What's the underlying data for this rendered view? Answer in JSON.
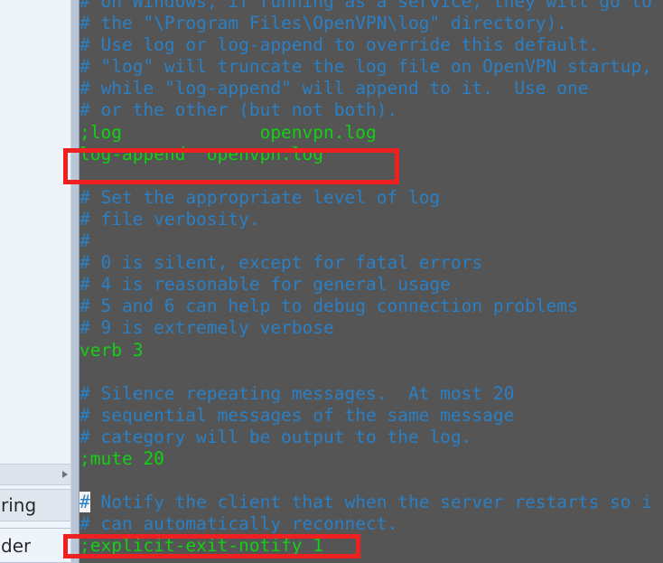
{
  "window": {
    "kind": "text-editor",
    "filename_hint": "openvpn config"
  },
  "colors": {
    "editor_background": "#555555",
    "comment_blue": "#2b7fc4",
    "directive_green": "#14d014",
    "annotation_red": "#ee2020",
    "desktop_background": "#eff3fa",
    "scrollbar_track": "#b9c6d8",
    "menu_background": "#dde3ec"
  },
  "background_app": {
    "submenu_row": {
      "label": "",
      "arrow_icon": "caret-right-icon"
    },
    "list_items": [
      {
        "label": "ring"
      },
      {
        "label": "der"
      }
    ]
  },
  "editor": {
    "lines": [
      {
        "id": 1,
        "type": "comment",
        "text": "# on Windows, if running as a service, they will go to"
      },
      {
        "id": 2,
        "type": "comment",
        "text": "# the \"\\Program Files\\OpenVPN\\log\" directory)."
      },
      {
        "id": 3,
        "type": "comment",
        "text": "# Use log or log-append to override this default."
      },
      {
        "id": 4,
        "type": "comment",
        "text": "# \"log\" will truncate the log file on OpenVPN startup,"
      },
      {
        "id": 5,
        "type": "comment",
        "text": "# while \"log-append\" will append to it.  Use one"
      },
      {
        "id": 6,
        "type": "comment",
        "text": "# or the other (but not both)."
      },
      {
        "id": 7,
        "type": "directive",
        "text": ";log             openvpn.log"
      },
      {
        "id": 8,
        "type": "directive",
        "text": "log-append  openvpn.log",
        "highlighted": true
      },
      {
        "id": 9,
        "type": "blank",
        "text": ""
      },
      {
        "id": 10,
        "type": "comment",
        "text": "# Set the appropriate level of log"
      },
      {
        "id": 11,
        "type": "comment",
        "text": "# file verbosity."
      },
      {
        "id": 12,
        "type": "comment",
        "text": "#"
      },
      {
        "id": 13,
        "type": "comment",
        "text": "# 0 is silent, except for fatal errors"
      },
      {
        "id": 14,
        "type": "comment",
        "text": "# 4 is reasonable for general usage"
      },
      {
        "id": 15,
        "type": "comment",
        "text": "# 5 and 6 can help to debug connection problems"
      },
      {
        "id": 16,
        "type": "comment",
        "text": "# 9 is extremely verbose"
      },
      {
        "id": 17,
        "type": "directive",
        "text": "verb 3"
      },
      {
        "id": 18,
        "type": "blank",
        "text": ""
      },
      {
        "id": 19,
        "type": "comment",
        "text": "# Silence repeating messages.  At most 20"
      },
      {
        "id": 20,
        "type": "comment",
        "text": "# sequential messages of the same message"
      },
      {
        "id": 21,
        "type": "comment",
        "text": "# category will be output to the log."
      },
      {
        "id": 22,
        "type": "directive",
        "text": ";mute 20"
      },
      {
        "id": 23,
        "type": "blank",
        "text": ""
      },
      {
        "id": 24,
        "type": "comment",
        "text": "# Notify the client that when the server restarts so i",
        "cursor_at_col": 0,
        "cursor_char": "#"
      },
      {
        "id": 25,
        "type": "comment",
        "text": "# can automatically reconnect."
      },
      {
        "id": 26,
        "type": "directive",
        "text": ";explicit-exit-notify 1",
        "highlighted": true
      }
    ]
  },
  "annotations": [
    {
      "name": "redbox-log-append",
      "target_line": 8,
      "shape": "rectangle",
      "color": "#ee2020"
    },
    {
      "name": "redbox-exit-notify",
      "target_line": 26,
      "shape": "rectangle",
      "color": "#ee2020"
    }
  ]
}
